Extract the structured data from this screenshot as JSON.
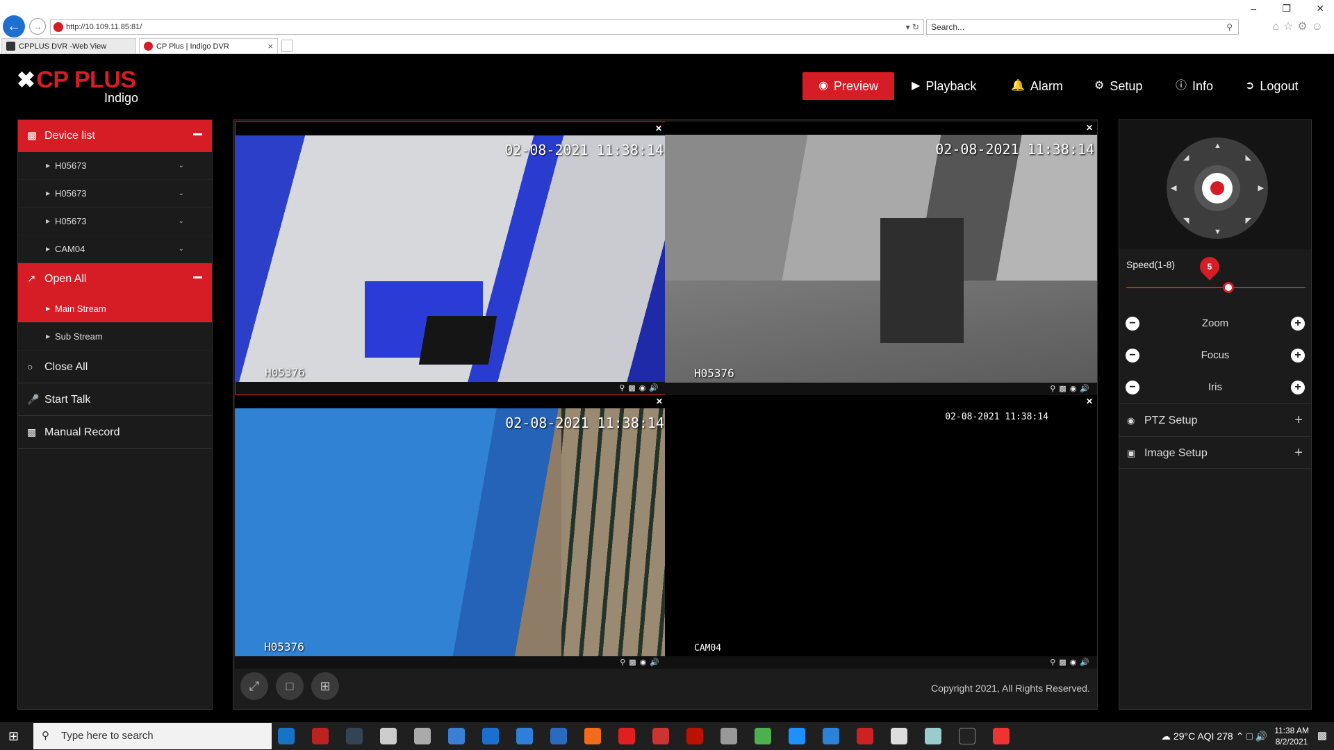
{
  "browser": {
    "url": "http://10.109.11.85:81/",
    "search_placeholder": "Search...",
    "tabs": [
      {
        "label": "CPPLUS DVR -Web View"
      },
      {
        "label": "CP Plus | Indigo DVR"
      }
    ]
  },
  "header": {
    "brand": "CP PLUS",
    "brand_sub": "Indigo",
    "nav": [
      {
        "label": "Preview",
        "icon": "eye-icon"
      },
      {
        "label": "Playback",
        "icon": "play-icon"
      },
      {
        "label": "Alarm",
        "icon": "bell-icon"
      },
      {
        "label": "Setup",
        "icon": "gear-icon"
      },
      {
        "label": "Info",
        "icon": "info-icon"
      },
      {
        "label": "Logout",
        "icon": "logout-icon"
      }
    ]
  },
  "sidebar": {
    "device_list_label": "Device list",
    "devices": [
      "H05673",
      "H05673",
      "H05673",
      "CAM04"
    ],
    "open_all_label": "Open All",
    "streams": [
      "Main Stream",
      "Sub Stream"
    ],
    "close_all_label": "Close All",
    "start_talk_label": "Start Talk",
    "manual_record_label": "Manual Record"
  },
  "cameras": [
    {
      "timestamp": "02-08-2021 11:38:14",
      "name": "H05376"
    },
    {
      "timestamp": "02-08-2021 11:38:14",
      "name": "H05376"
    },
    {
      "timestamp": "02-08-2021 11:38:14",
      "name": "H05376"
    },
    {
      "timestamp": "02-08-2021 11:38:14",
      "name": "CAM04"
    }
  ],
  "footer": {
    "copyright": "Copyright 2021, All Rights Reserved."
  },
  "ptz": {
    "speed_label": "Speed(1-8)",
    "speed_value": "5",
    "speed_fraction": 0.57,
    "zoom_label": "Zoom",
    "focus_label": "Focus",
    "iris_label": "Iris",
    "ptz_setup_label": "PTZ Setup",
    "image_setup_label": "Image Setup"
  },
  "taskbar": {
    "search_placeholder": "Type here to search",
    "weather": "29°C",
    "aqi": "AQI 278",
    "time": "11:38 AM",
    "date": "8/2/2021"
  },
  "colors": {
    "accent": "#d61c24",
    "panel": "#1b1b1b"
  }
}
